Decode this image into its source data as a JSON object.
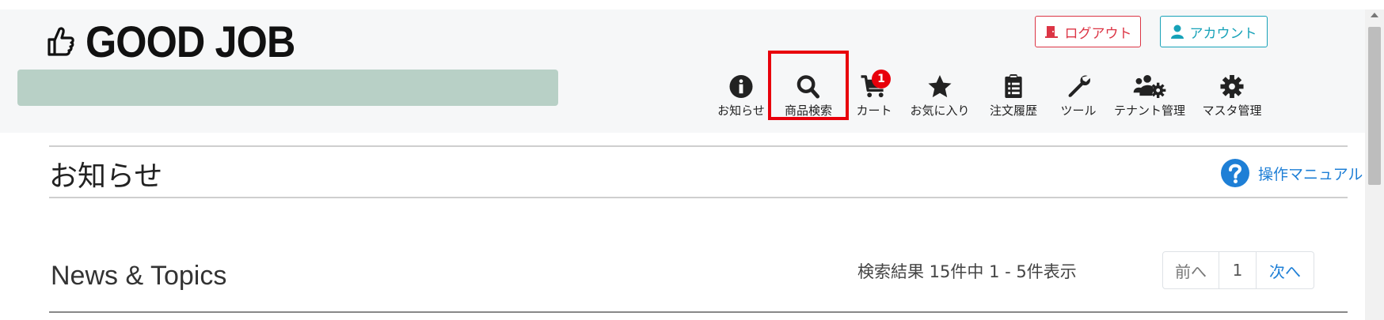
{
  "header": {
    "logo_text": "GOOD JOB",
    "logout_label": "ログアウト",
    "account_label": "アカウント"
  },
  "nav": [
    {
      "label": "お知らせ",
      "icon": "info-circle-icon"
    },
    {
      "label": "商品検索",
      "icon": "search-icon",
      "highlighted": true
    },
    {
      "label": "カート",
      "icon": "cart-icon",
      "badge": "1"
    },
    {
      "label": "お気に入り",
      "icon": "star-icon"
    },
    {
      "label": "注文履歴",
      "icon": "clipboard-list-icon"
    },
    {
      "label": "ツール",
      "icon": "wrench-icon"
    },
    {
      "label": "テナント管理",
      "icon": "users-cog-icon"
    },
    {
      "label": "マスタ管理",
      "icon": "gear-icon"
    }
  ],
  "colors": {
    "highlight": "#e8000b",
    "company_bar": "#b8d0c6",
    "link": "#1e7fd6",
    "logout": "#dc3545",
    "account": "#17a2b8"
  },
  "main": {
    "page_title": "お知らせ",
    "manual_label": "操作マニュアル",
    "section_title": "News & Topics",
    "result_text": "検索結果 15件中 1 - 5件表示",
    "pagination": {
      "prev": "前へ",
      "current": "1",
      "next": "次へ"
    }
  }
}
